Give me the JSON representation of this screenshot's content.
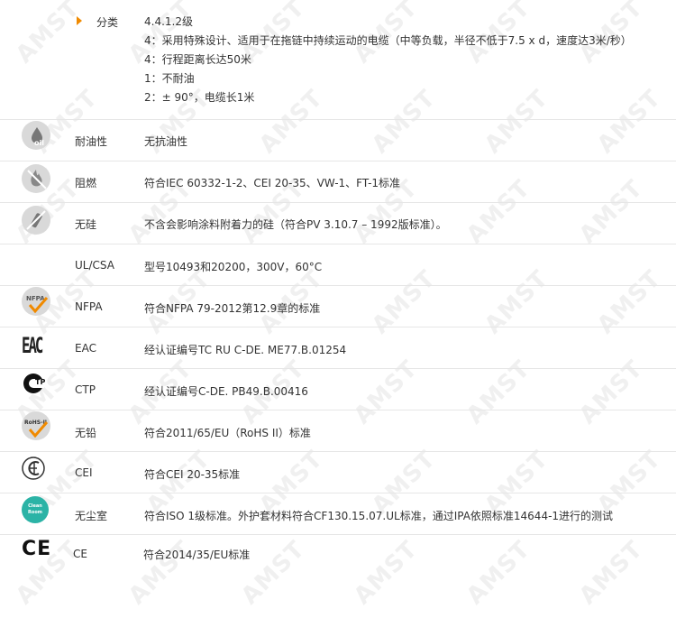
{
  "classification": {
    "label": "分类",
    "lines": [
      "4.4.1.2级",
      "4：采用特殊设计、适用于在拖链中持续运动的电缆（中等负载，半径不低于7.5 x d，速度达3米/秒）",
      "4：行程距离长达50米",
      "1：不耐油",
      "2：± 90°，电缆长1米"
    ]
  },
  "rows": [
    {
      "icon": "oil-resistance-icon",
      "icon_text": "oil",
      "label": "耐油性",
      "value": "无抗油性"
    },
    {
      "icon": "flame-retardant-icon",
      "icon_text": "",
      "label": "阻燃",
      "value": "符合IEC 60332-1-2、CEI 20-35、VW-1、FT-1标准"
    },
    {
      "icon": "silicone-free-icon",
      "icon_text": "",
      "label": "无硅",
      "value": "不含会影响涂料附着力的硅（符合PV 3.10.7 – 1992版标准）。"
    },
    {
      "icon": "",
      "icon_text": "",
      "label": "UL/CSA",
      "value": "型号10493和20200，300V，60°C"
    },
    {
      "icon": "nfpa-icon",
      "icon_text": "NFPA",
      "label": "NFPA",
      "value": "符合NFPA 79-2012第12.9章的标准"
    },
    {
      "icon": "eac-icon",
      "icon_text": "EAC",
      "label": "EAC",
      "value": "经认证编号TC RU C-DE. ME77.B.01254"
    },
    {
      "icon": "ctp-icon",
      "icon_text": "TP",
      "label": "CTP",
      "value": "经认证编号C-DE. PB49.B.00416"
    },
    {
      "icon": "rohs-icon",
      "icon_text": "RoHS-II",
      "label": "无铅",
      "value": "符合2011/65/EU（RoHS II）标准"
    },
    {
      "icon": "cei-icon",
      "icon_text": "",
      "label": "CEI",
      "value": "符合CEI 20-35标准"
    },
    {
      "icon": "clean-room-icon",
      "icon_text": "Clean Room",
      "label": "无尘室",
      "value": "符合ISO 1级标准。外护套材料符合CF130.15.07.UL标准，通过IPA依照标准14644-1进行的测试"
    },
    {
      "icon": "ce-icon",
      "icon_text": "CE",
      "label": "CE",
      "value": "符合2014/35/EU标准"
    }
  ],
  "watermark": "AMST",
  "colors": {
    "accent": "#f08a00",
    "text": "#333333",
    "divider": "#e6e6e6",
    "icon_gray": "#d9d9d9",
    "clean_room": "#2bb3a6"
  }
}
